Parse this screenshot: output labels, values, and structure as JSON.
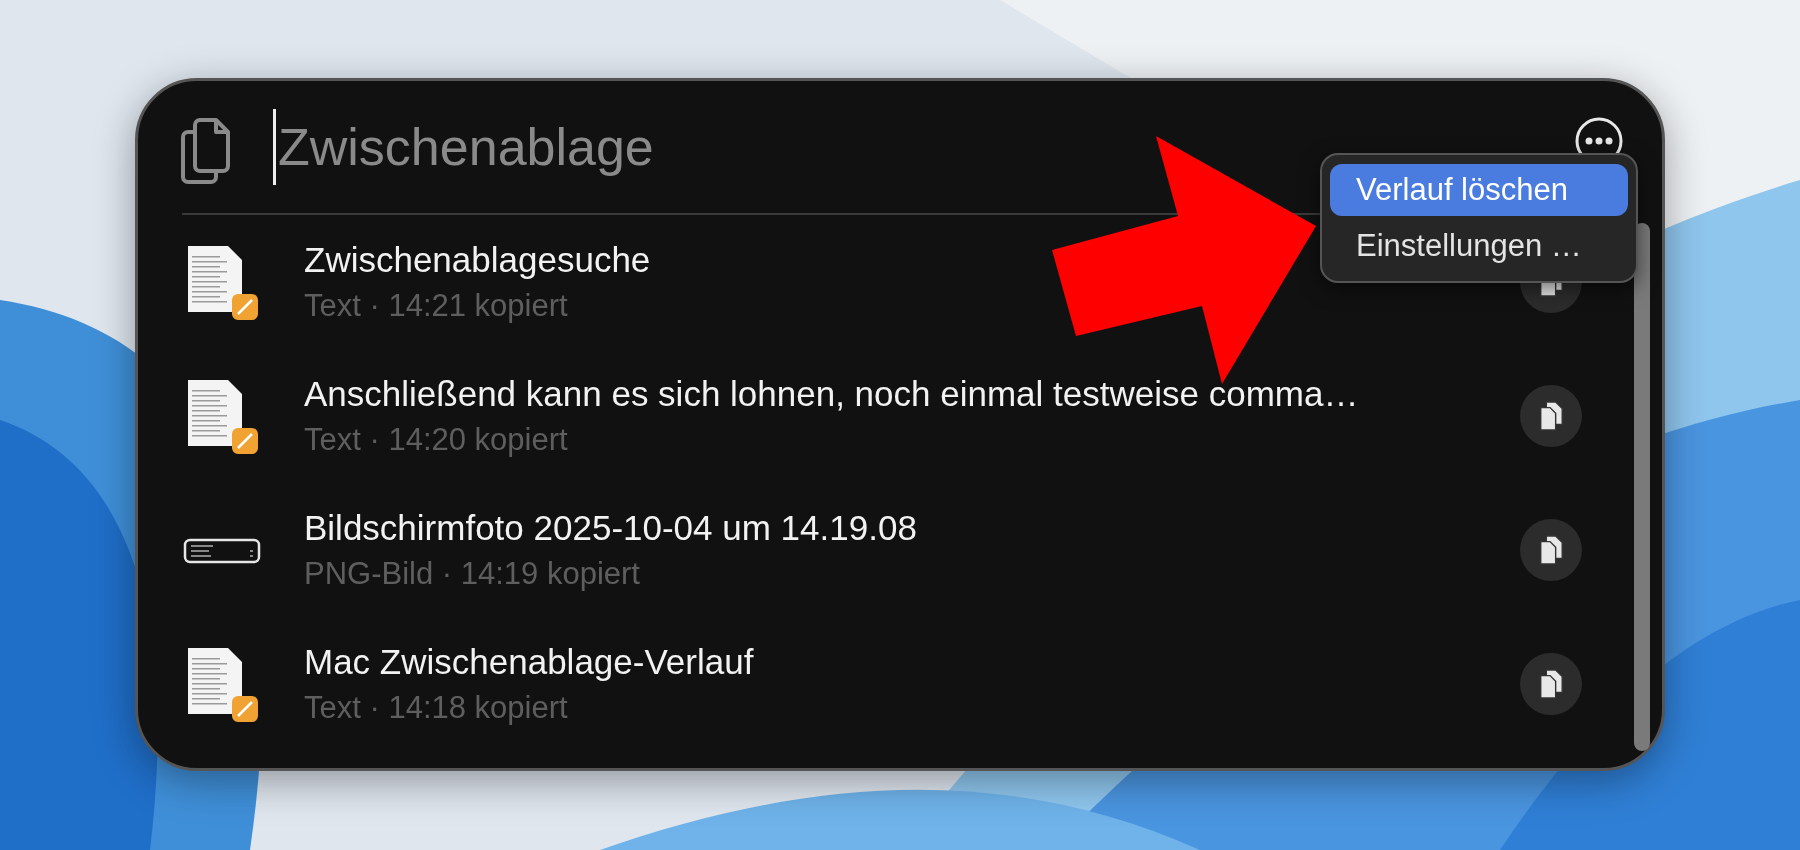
{
  "search": {
    "placeholder": "Zwischenablage"
  },
  "menu": {
    "items": [
      {
        "label": "Verlauf löschen",
        "selected": true
      },
      {
        "label": "Einstellungen …",
        "selected": false
      }
    ]
  },
  "items": [
    {
      "kind": "text",
      "title": "Zwischenablagesuche",
      "meta": "Text · 14:21 kopiert"
    },
    {
      "kind": "text",
      "title": "Anschließend kann es sich lohnen, noch einmal testweise comma…",
      "meta": "Text · 14:20 kopiert"
    },
    {
      "title": "Bildschirmfoto 2025-10-04 um 14.19.08",
      "meta": "PNG-Bild · 14:19 kopiert"
    },
    {
      "kind": "text",
      "title": "Mac Zwischenablage-Verlauf",
      "meta": "Text · 14:18 kopiert"
    }
  ]
}
